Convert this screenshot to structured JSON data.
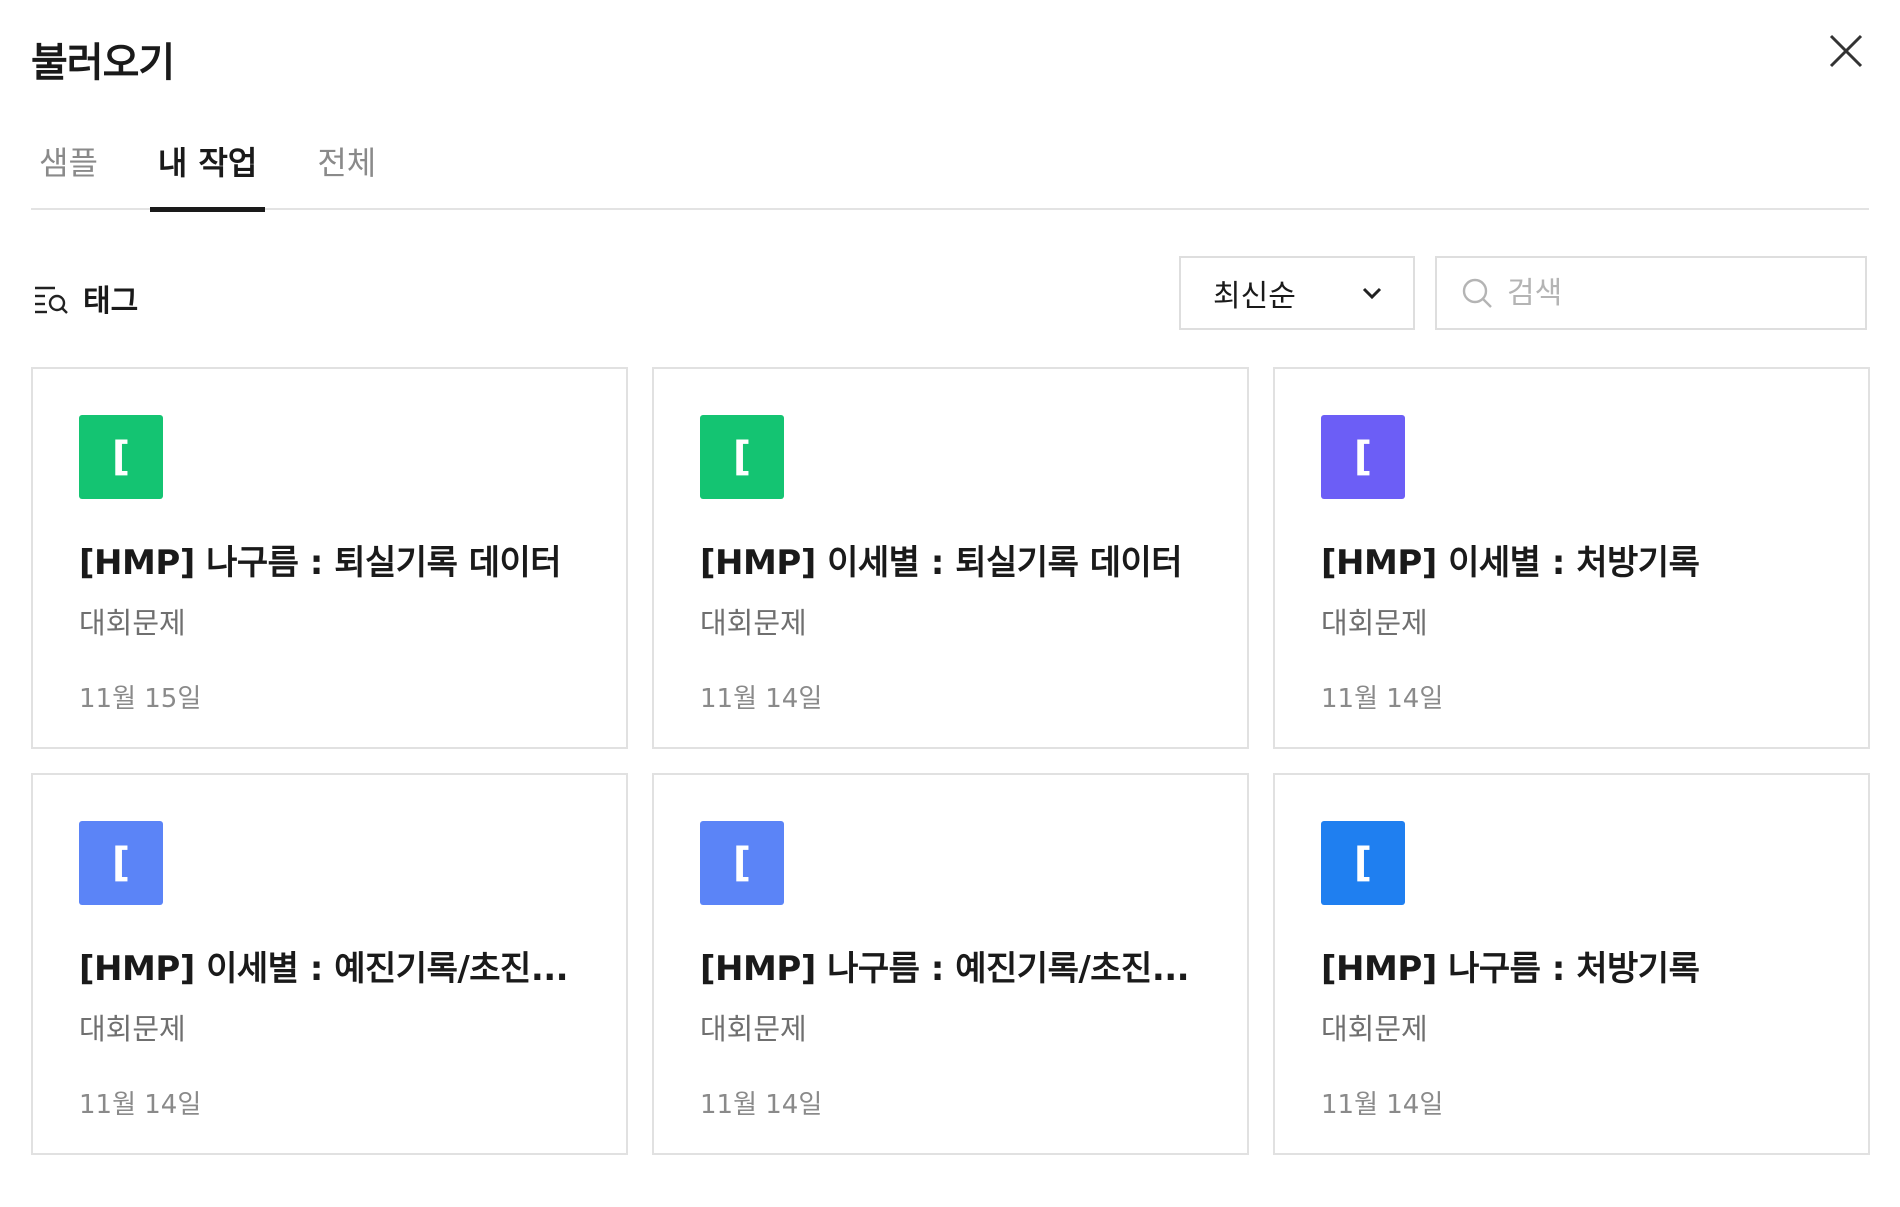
{
  "modal": {
    "title": "불러오기"
  },
  "tabs": [
    {
      "label": "샘플",
      "active": false
    },
    {
      "label": "내 작업",
      "active": true
    },
    {
      "label": "전체",
      "active": false
    }
  ],
  "toolbar": {
    "tag_label": "태그",
    "sort_value": "최신순",
    "search_placeholder": "검색"
  },
  "cards": [
    {
      "icon_char": "[",
      "icon_color": "#14c472",
      "title": "[HMP] 나구름 : 퇴실기록 데이터",
      "category": "대회문제",
      "date": "11월 15일"
    },
    {
      "icon_char": "[",
      "icon_color": "#14c472",
      "title": "[HMP] 이세별 : 퇴실기록 데이터",
      "category": "대회문제",
      "date": "11월 14일"
    },
    {
      "icon_char": "[",
      "icon_color": "#6c5ef6",
      "title": "[HMP] 이세별 : 처방기록",
      "category": "대회문제",
      "date": "11월 14일"
    },
    {
      "icon_char": "[",
      "icon_color": "#5b84f7",
      "title": "[HMP] 이세별 : 예진기록/초진...",
      "category": "대회문제",
      "date": "11월 14일"
    },
    {
      "icon_char": "[",
      "icon_color": "#5b84f7",
      "title": "[HMP] 나구름 : 예진기록/초진...",
      "category": "대회문제",
      "date": "11월 14일"
    },
    {
      "icon_char": "[",
      "icon_color": "#1f7ff0",
      "title": "[HMP] 나구름 : 처방기록",
      "category": "대회문제",
      "date": "11월 14일"
    }
  ]
}
